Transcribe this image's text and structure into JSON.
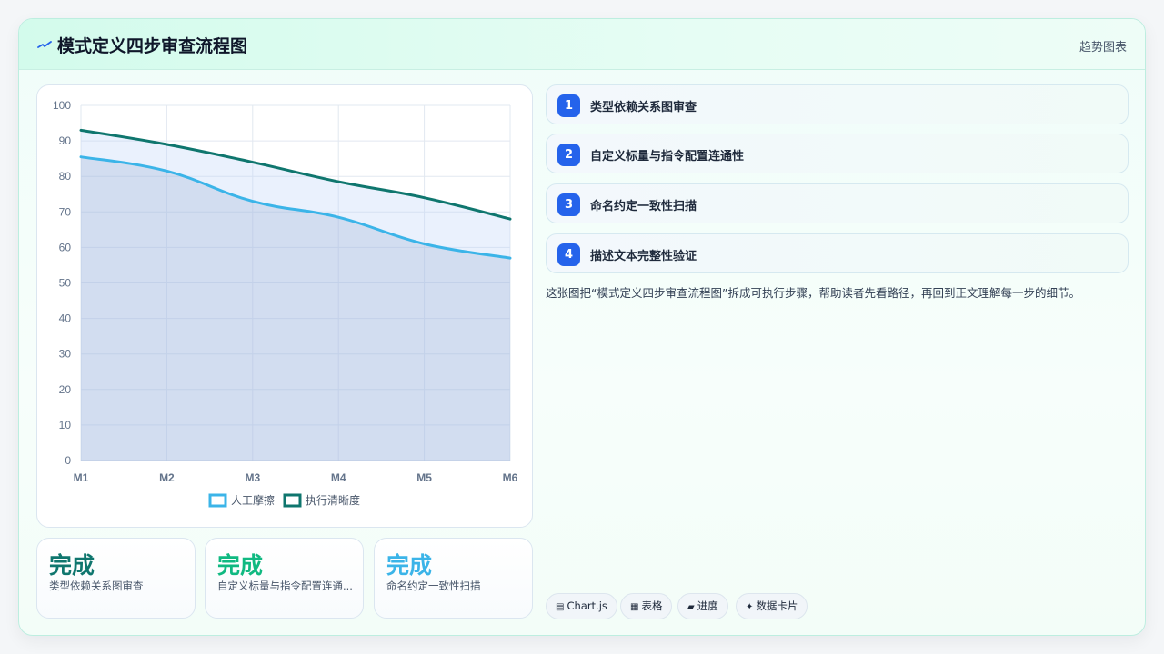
{
  "header": {
    "title": "模式定义四步审查流程图",
    "tag": "趋势图表"
  },
  "chart_data": {
    "type": "area",
    "categories": [
      "M1",
      "M2",
      "M3",
      "M4",
      "M5",
      "M6"
    ],
    "series": [
      {
        "name": "人工摩擦",
        "values": [
          85.5,
          81.5,
          73,
          68.5,
          61,
          57
        ],
        "color": "#3bb4e8"
      },
      {
        "name": "执行清晰度",
        "values": [
          93,
          89,
          84,
          78.5,
          74,
          68
        ],
        "color": "#0f766e"
      }
    ],
    "ylim": [
      0,
      100
    ],
    "yticks": [
      0,
      10,
      20,
      30,
      40,
      50,
      60,
      70,
      80,
      90,
      100
    ],
    "grid": true,
    "legend": "bottom",
    "title": "",
    "xlabel": "",
    "ylabel": ""
  },
  "kpis": [
    {
      "value": "完成",
      "label": "类型依赖关系图审查",
      "color": "#0f766e"
    },
    {
      "value": "完成",
      "label": "自定义标量与指令配置连通...",
      "color": "#10b981"
    },
    {
      "value": "完成",
      "label": "命名约定一致性扫描",
      "color": "#3bb4e8"
    }
  ],
  "steps": [
    {
      "num": "1",
      "label": "类型依赖关系图审查"
    },
    {
      "num": "2",
      "label": "自定义标量与指令配置连通性"
    },
    {
      "num": "3",
      "label": "命名约定一致性扫描"
    },
    {
      "num": "4",
      "label": "描述文本完整性验证"
    }
  ],
  "description": "这张图把“模式定义四步审查流程图”拆成可执行步骤，帮助读者先看路径，再回到正文理解每一步的细节。",
  "chips": [
    {
      "icon": "▤",
      "label": "Chart.js",
      "icon_name": "chart-icon"
    },
    {
      "icon": "▦",
      "label": "表格",
      "icon_name": "table-icon"
    },
    {
      "icon": "▰",
      "label": "进度",
      "icon_name": "progress-icon"
    },
    {
      "icon": "✦",
      "label": "数据卡片",
      "icon_name": "sparkle-icon"
    }
  ],
  "colors": {
    "accent": "#2563eb",
    "brand_green": "#0f766e",
    "brand_sky": "#3bb4e8"
  }
}
